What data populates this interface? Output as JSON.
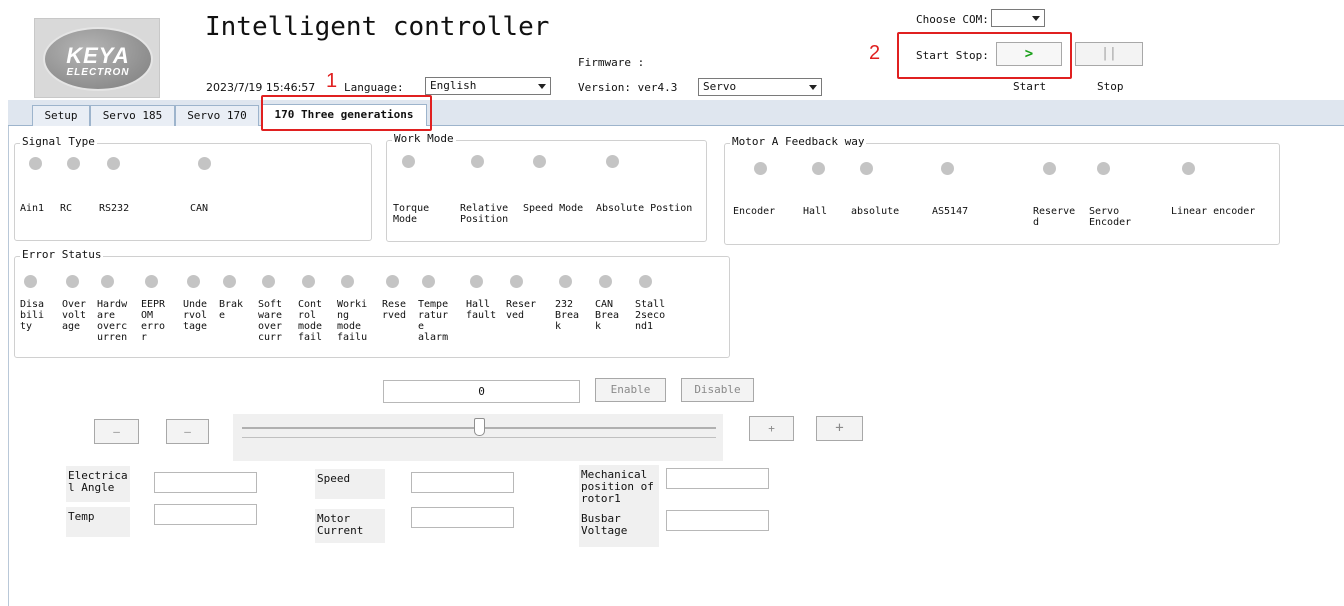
{
  "logo": {
    "line1": "KEYA",
    "line2": "ELECTRON"
  },
  "header": {
    "title": "Intelligent controller",
    "datetime": "2023/7/19 15:46:57",
    "annotation1": "1",
    "language_label": "Language:",
    "language_value": "English",
    "firmware_label": "Firmware :",
    "version_label": "Version: ver4.3",
    "mode_value": "Servo",
    "choose_com_label": "Choose COM:",
    "choose_com_value": "",
    "annotation2": "2",
    "start_stop_label": "Start Stop:",
    "start_icon": ">",
    "stop_icon": "||",
    "start_label": "Start",
    "stop_label": "Stop"
  },
  "tabs": [
    {
      "label": "Setup"
    },
    {
      "label": "Servo 185"
    },
    {
      "label": "Servo 170"
    },
    {
      "label": "170 Three generations"
    }
  ],
  "signal_type": {
    "title": "Signal Type",
    "items": [
      "Ain1",
      "RC",
      "RS232",
      "CAN"
    ]
  },
  "work_mode": {
    "title": "Work Mode",
    "items": [
      "Torque\nMode",
      "Relative\nPosition",
      "Speed Mode",
      "Absolute Postion"
    ]
  },
  "feedback": {
    "title": "Motor A Feedback way",
    "items": [
      "Encoder",
      "Hall",
      "absolute",
      "AS5147",
      "Reserve\nd",
      "Servo\nEncoder",
      "Linear encoder"
    ]
  },
  "error_status": {
    "title": "Error Status",
    "items": [
      "Disa\nbili\nty",
      "Over\nvolt\nage",
      "Hardw\nare\noverc\nurren",
      "EEPR\nOM\nerro\nr",
      "Unde\nrvol\ntage",
      "Brak\ne",
      "Soft\nware\nover\ncurr",
      "Cont\nrol\nmode\nfail",
      "Worki\nng\nmode\nfailu",
      "Rese\nrved",
      "Tempe\nratur\ne\nalarm",
      "Hall\nfault",
      "Reser\nved",
      "232\nBrea\nk",
      "CAN\nBrea\nk",
      "Stall\n2seco\nnd1"
    ]
  },
  "control": {
    "value": "0",
    "enable_label": "Enable",
    "disable_label": "Disable",
    "minus_big": "—",
    "minus_small": "–",
    "plus_small": "+",
    "plus_big": "+",
    "slider_level": 0.5
  },
  "readouts": {
    "electrical_angle": "Electrica\nl Angle",
    "temp": "Temp",
    "speed": "Speed",
    "motor_current": "Motor\nCurrent",
    "mechanical_position": "Mechanical\nposition of\nrotor1",
    "busbar_voltage": "Busbar\nVoltage"
  }
}
